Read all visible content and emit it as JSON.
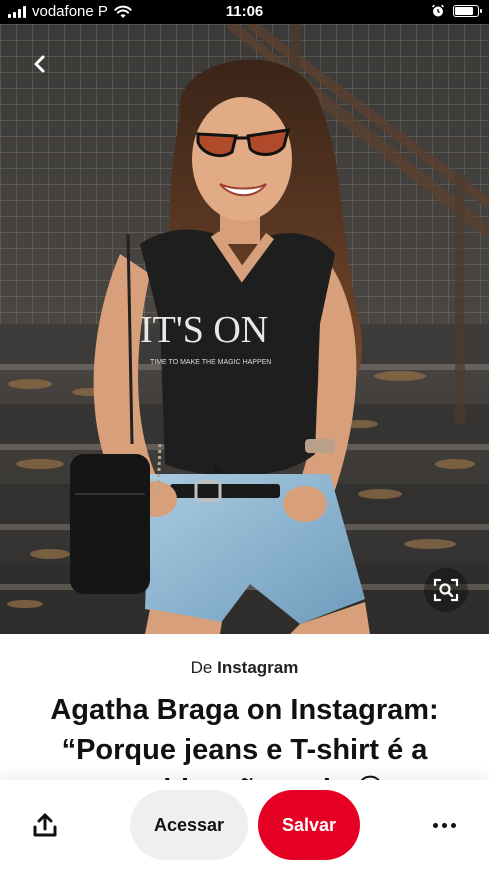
{
  "status_bar": {
    "carrier": "vodafone P",
    "time": "11:06",
    "battery_level": 0.85
  },
  "icons": {
    "back": "chevron-left-icon",
    "visual_search": "visual-search-icon",
    "share": "share-icon",
    "more": "more-horizontal-icon",
    "alarm": "alarm-clock-icon",
    "wifi": "wifi-icon",
    "signal": "signal-icon",
    "battery": "battery-icon"
  },
  "pin": {
    "source_prefix": "De",
    "source_name": "Instagram",
    "title": "Agatha Braga on Instagram: “Porque jeans e T-shirt é a combinação mais 😍"
  },
  "photo": {
    "shirt_text": "IT'S ON",
    "shirt_subtext": "TIME TO MAKE THE MAGIC HAPPEN"
  },
  "actions": {
    "visit_label": "Acessar",
    "save_label": "Salvar"
  },
  "colors": {
    "save_button": "#e60023",
    "visit_button": "#efefef",
    "status_bar": "#000000"
  }
}
